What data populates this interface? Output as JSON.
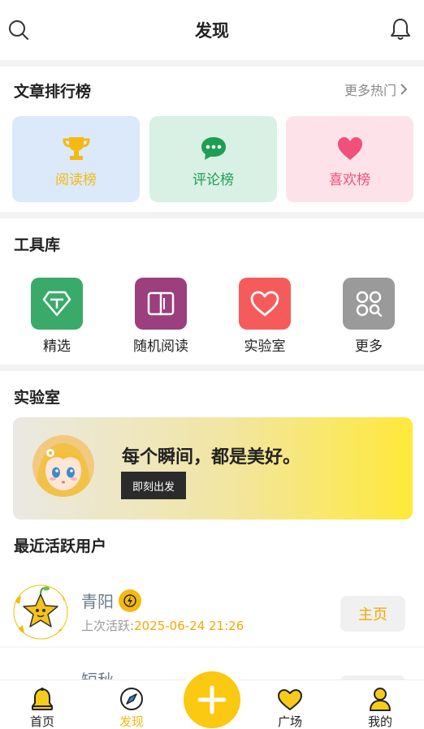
{
  "header": {
    "title": "发现"
  },
  "rankings": {
    "title": "文章排行榜",
    "more_label": "更多热门",
    "cards": [
      {
        "label": "阅读榜",
        "icon": "trophy-icon",
        "color": "#f5b90f",
        "bg": "#dbe9fb"
      },
      {
        "label": "评论榜",
        "icon": "chat-bubble-icon",
        "color": "#1e9e55",
        "bg": "#d9f0e5"
      },
      {
        "label": "喜欢榜",
        "icon": "heart-icon",
        "color": "#f0507a",
        "bg": "#fde3e9"
      }
    ]
  },
  "tools": {
    "title": "工具库",
    "items": [
      {
        "label": "精选",
        "icon": "diamond-icon",
        "color": "#3aaa6a"
      },
      {
        "label": "随机阅读",
        "icon": "book-icon",
        "color": "#9b3f7e"
      },
      {
        "label": "实验室",
        "icon": "heart-outline-icon",
        "color": "#f65b5b"
      },
      {
        "label": "更多",
        "icon": "grid-search-icon",
        "color": "#9a9a9a"
      }
    ]
  },
  "lab": {
    "title": "实验室",
    "slogan": "每个瞬间，都是美好。",
    "button_label": "即刻出发"
  },
  "active_users": {
    "title": "最近活跃用户",
    "users": [
      {
        "name": "青阳",
        "active_prefix": "上次活跃:",
        "active_time": "2025-06-24 21:26",
        "button": "主页"
      },
      {
        "name": "短秋",
        "active_prefix": "",
        "active_time": "",
        "button": ""
      }
    ]
  },
  "tabbar": {
    "tabs": [
      {
        "label": "首页",
        "icon": "bell-home-icon"
      },
      {
        "label": "发现",
        "icon": "compass-icon",
        "active": true
      },
      {
        "label": "广场",
        "icon": "heart-tab-icon"
      },
      {
        "label": "我的",
        "icon": "user-icon"
      }
    ],
    "accent": "#f5b90f"
  }
}
